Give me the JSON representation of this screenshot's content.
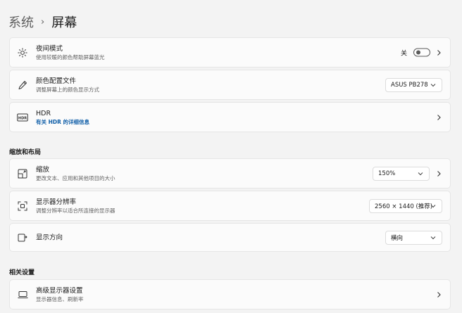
{
  "breadcrumb": {
    "parent": "系统",
    "separator": "›",
    "current": "屏幕"
  },
  "night_light": {
    "title": "夜间模式",
    "desc": "使用较暖的颜色帮助屏幕蓝光",
    "toggle_label": "关",
    "toggle_state": "off"
  },
  "color_profile": {
    "title": "颜色配置文件",
    "desc": "调整屏幕上的颜色显示方式",
    "value": "ASUS PB278"
  },
  "hdr": {
    "title": "HDR",
    "link": "有关 HDR 的详细信息"
  },
  "scale_layout": {
    "section_title": "缩放和布局",
    "scale": {
      "title": "缩放",
      "desc": "更改文本、应用和其他项目的大小",
      "value": "150%"
    },
    "resolution": {
      "title": "显示器分辨率",
      "desc": "调整分辨率以适合所连接的显示器",
      "value": "2560 × 1440 (推荐)"
    },
    "orientation": {
      "title": "显示方向",
      "value": "横向"
    }
  },
  "related": {
    "section_title": "相关设置",
    "advanced": {
      "title": "高级显示器设置",
      "desc": "显示器信息、刷新率"
    }
  }
}
